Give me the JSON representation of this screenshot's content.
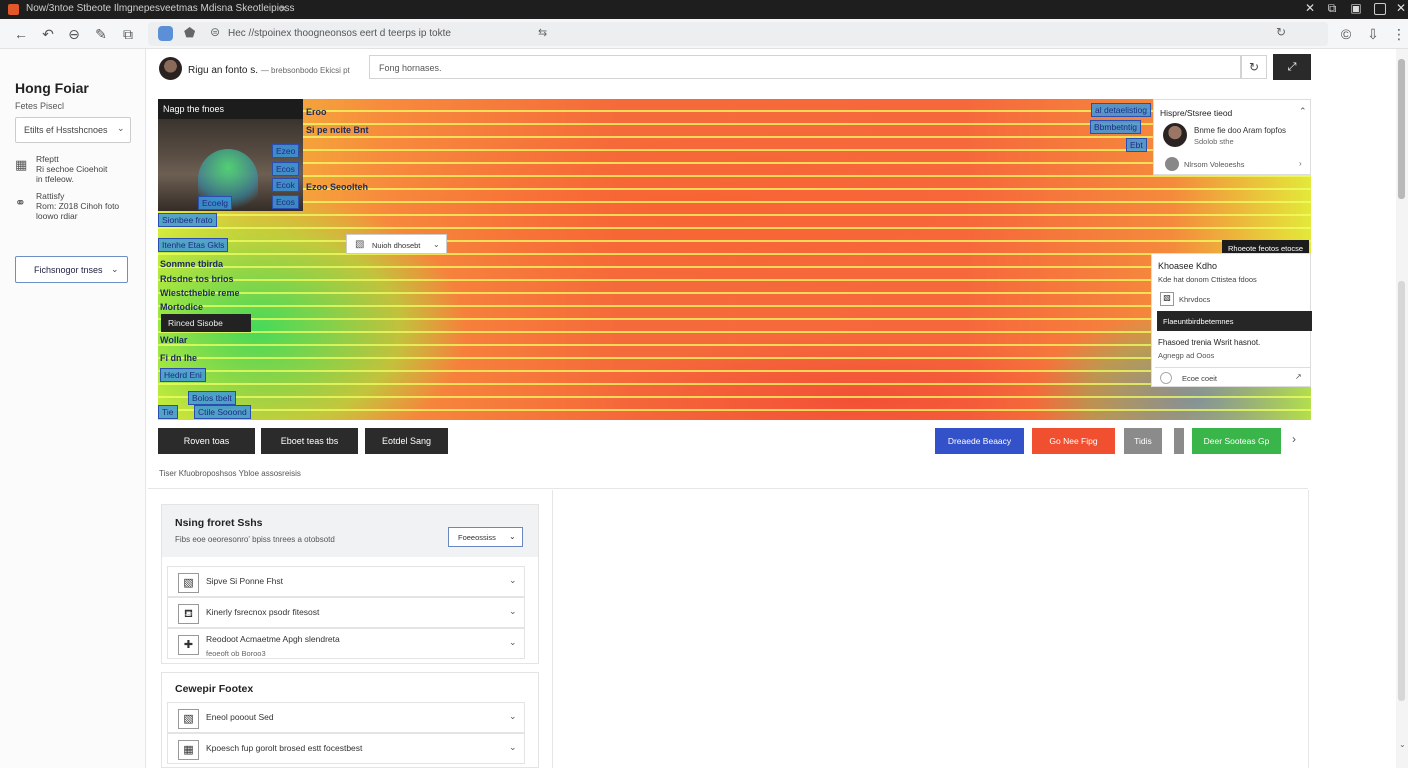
{
  "window": {
    "title": "Now/3ntoe Stbeote Ilmgnepesveetmas Mdisna Skeotleipiess",
    "close_tab": "⨯",
    "controls": [
      "✕",
      "⧉",
      "▣",
      "✕"
    ]
  },
  "browser": {
    "url": "Hec //stpoinex thoogneonsos eert d teerps ip tokte",
    "nav_icons": [
      "back-icon",
      "forward-icon",
      "home-icon",
      "edit-icon",
      "bookmark-icon"
    ],
    "right_icons": [
      "account-icon",
      "download-icon",
      "menu-icon"
    ]
  },
  "sidebar": {
    "title": "Hong Foiar",
    "subtitle": "Fetes Pisecl",
    "select_value": "Etilts ef Hsstshcnoes",
    "items": [
      {
        "icon": "grid-icon",
        "lines": [
          "Rfeptt",
          "Ri sechoe Cioehoit",
          "in tfeleow."
        ]
      },
      {
        "icon": "link-icon",
        "lines": [
          "Rattisfy",
          "Rom: Z018 Cihoh foto",
          "loowo rdiar"
        ]
      }
    ],
    "button_label": "Fichsnogor tnses"
  },
  "header": {
    "user_name": "Rigu an fonto s.",
    "user_meta": "— brebsonbodo Ekicsi pt",
    "search_placeholder": "Fong hornases.",
    "search_icon": "refresh-icon",
    "expand_icon": "expand-icon"
  },
  "heatmap": {
    "header": "Nagp the fnoes",
    "tags_right": [
      "al detaelistiog",
      "Bbmbetntig",
      "Ebt"
    ],
    "tags_left": [
      "Ezeo",
      "Ecos",
      "Ecok",
      "Ecos",
      "Ecoelg",
      "Sionbee frato",
      "Itenhe Etas Gkls"
    ],
    "labels_top": [
      "Eroo",
      "Si pe ncite Bnt",
      "Ezoo Seoolteh"
    ],
    "labels_left": [
      "Sonmne tbirda",
      "Rdsdne tos brios",
      "Wiestcthebie reme",
      "Mortodice",
      "Wollar",
      "Fi dn lhe",
      "Hedrd Eni",
      "Bolos tbelt"
    ],
    "dark_label": "Rinced Sisobe",
    "popup_label": "Nuioh dhosebt",
    "popup_chevron": "⌄",
    "bottom_tags": [
      "Ctile Sooond",
      "Tie"
    ]
  },
  "right_panel": {
    "top_header": "Hispre/Stsree tieod",
    "top_person_line1": "Bnme fie doo Aram fopfos",
    "top_person_line2": "Sdolob sthe",
    "top_link": "Nlrsom Voleoeshs",
    "dark_button": "Rhoeote feotos etocse",
    "mid_header": "Khoasee Kdho",
    "mid_sub": "Kde hat donom Cttistea fdoos",
    "mid_row": "Khrvdocs",
    "mid_bar": "Flaeuntbirdbetemnes",
    "mid_line2": "Fhasoed trenia Wsrit hasnot.",
    "mid_line3": "Agnegp ad Ooos",
    "mid_bottom": "Ecoe coeit"
  },
  "actions": {
    "dark_buttons": [
      "Roven toas",
      "Eboet teas tbs",
      "Eotdel Sang"
    ],
    "blue_button": "Dreaede Beaacy",
    "red_button": "Go Nee Fipg",
    "gray_button": "Tidis",
    "green_button": "Deer Sooteas Gp",
    "colors": {
      "blue": "#3351c9",
      "red": "#f0502f",
      "gray": "#8b8b8b",
      "green": "#39b54a"
    }
  },
  "section_caption": "Tiser Kfuobroposhsos Ybloe assosreisis",
  "settings": {
    "card1": {
      "title": "Nsing froret Sshs",
      "description": "Fibs eoe oeoresonro' bpiss tnrees a otobsotd",
      "dropdown": "Foeeossiss",
      "options": [
        {
          "icon": "image-icon",
          "label": "Sipve Si Ponne Fhst",
          "sub": ""
        },
        {
          "icon": "cup-icon",
          "label": "Kinerly fsrecnox psodr fitesost",
          "sub": ""
        },
        {
          "icon": "plus-icon",
          "label": "Reodoot Acmaetme Apgh slendreta",
          "sub": "feoeoft ob Boroo3"
        }
      ]
    },
    "card2": {
      "title": "Cewepir Footex",
      "options": [
        {
          "icon": "image-icon",
          "label": "Eneol pooout Sed"
        },
        {
          "icon": "grid-icon",
          "label": "Kpoesch fup gorolt brosed estt focestbest"
        }
      ]
    }
  }
}
